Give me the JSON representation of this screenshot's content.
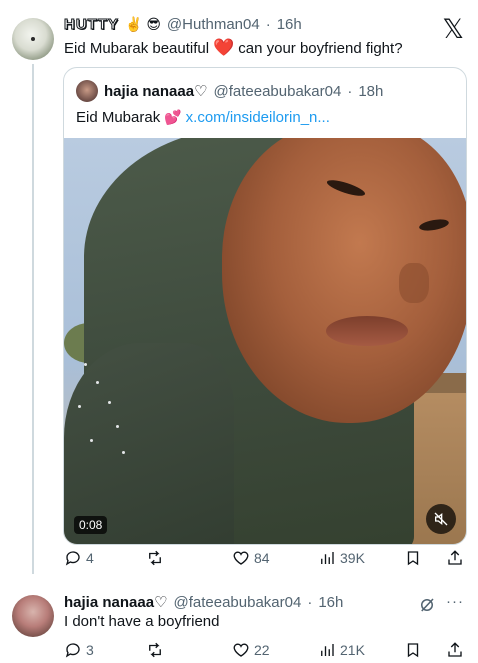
{
  "main_tweet": {
    "display_name": "HUTTY",
    "name_emojis": "✌️ 😎",
    "handle": "@Huthman04",
    "time": "16h",
    "text_before": "Eid Mubarak beautiful",
    "text_emoji": "❤️",
    "text_after": "can your boyfriend fight?"
  },
  "quoted_tweet": {
    "display_name": "hajia nanaaa",
    "name_suffix": "♡",
    "handle": "@fateeabubakar04",
    "time": "18h",
    "text": "Eid Mubarak",
    "text_emoji": "💕",
    "link": "x.com/insideilorin_n...",
    "video_time": "0:08"
  },
  "main_actions": {
    "replies": "4",
    "reposts": "",
    "likes": "84",
    "views": "39K"
  },
  "reply_tweet": {
    "display_name": "hajia nanaaa",
    "name_suffix": "♡",
    "handle": "@fateeabubakar04",
    "time": "16h",
    "text": "I don't have a boyfriend",
    "more": "···"
  },
  "reply_actions": {
    "replies": "3",
    "reposts": "",
    "likes": "22",
    "views": "21K"
  },
  "separators": {
    "dot": "·"
  },
  "logo": "𝕏"
}
